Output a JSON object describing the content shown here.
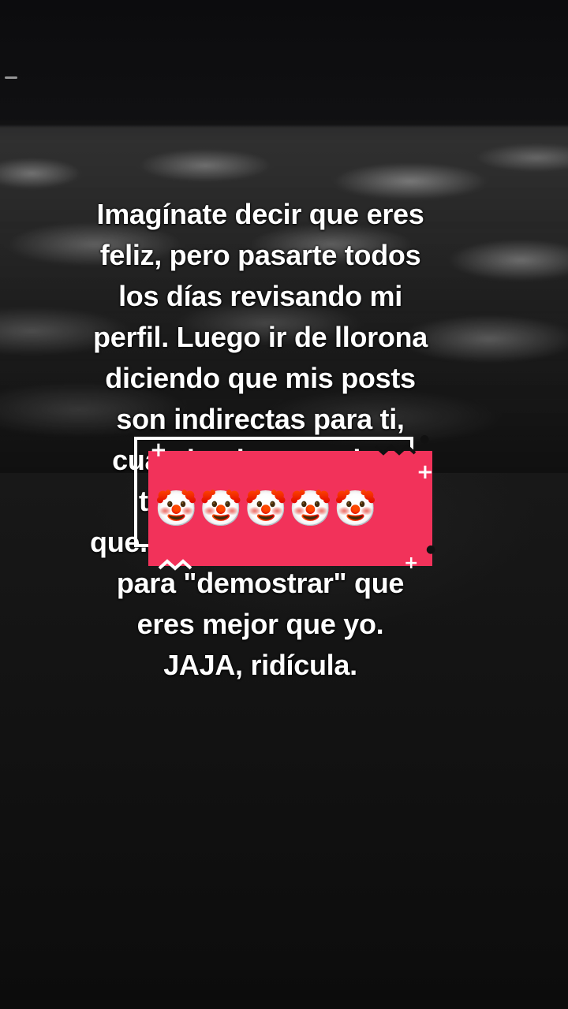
{
  "caption": {
    "lines": [
      "Imagínate decir que eres",
      "feliz, pero pasarte todos",
      "los días revisando mi",
      "perfil. Luego ir de llorona",
      "diciendo que mis posts",
      "son indirectas para ti,",
      "cuando ni agregada te",
      "tengo.",
      "que.",
      "para \"demostrar\" que",
      "eres mejor que yo.",
      "JAJA, ridícula."
    ]
  },
  "sticker": {
    "emoji": "🤡🤡🤡🤡🤡",
    "fill_color": "#f2325a",
    "outline_color": "#ffffff",
    "plus_glyph": "+"
  },
  "colors": {
    "text": "#ffffff",
    "background": "#0d0d0d"
  }
}
